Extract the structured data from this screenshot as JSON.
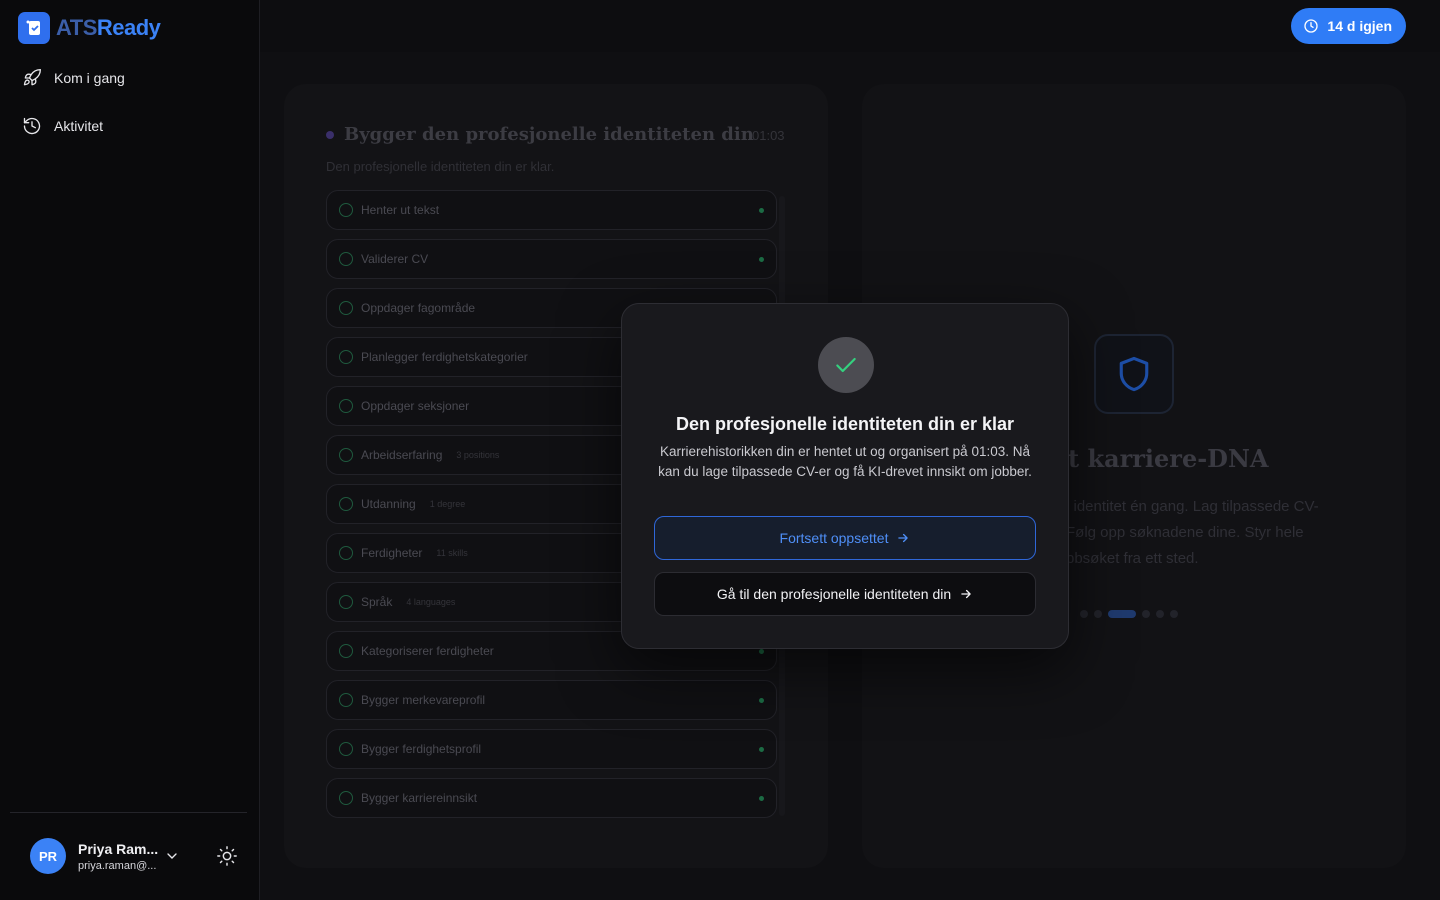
{
  "brand": {
    "name_part1": "ATS",
    "name_part2": "Ready"
  },
  "sidebar": {
    "nav": [
      {
        "label": "Kom i gang",
        "icon": "rocket-icon"
      },
      {
        "label": "Aktivitet",
        "icon": "history-icon"
      }
    ],
    "user": {
      "initials": "PR",
      "name": "Priya Ram...",
      "email": "priya.raman@..."
    }
  },
  "topbar": {
    "trial_label": "14 d igjen"
  },
  "background": {
    "progress_title": "Bygger den profesjonelle identiteten din",
    "progress_time": "01:03",
    "progress_subtitle": "Den profesjonelle identiteten din er klar.",
    "steps": [
      {
        "label": "Henter ut tekst",
        "meta": ""
      },
      {
        "label": "Validerer CV",
        "meta": ""
      },
      {
        "label": "Oppdager fagområde",
        "meta": ""
      },
      {
        "label": "Planlegger ferdighetskategorier",
        "meta": ""
      },
      {
        "label": "Oppdager seksjoner",
        "meta": ""
      },
      {
        "label": "Arbeidserfaring",
        "meta": "3 positions"
      },
      {
        "label": "Utdanning",
        "meta": "1 degree"
      },
      {
        "label": "Ferdigheter",
        "meta": "11 skills"
      },
      {
        "label": "Språk",
        "meta": "4 languages"
      },
      {
        "label": "Kategoriserer ferdigheter",
        "meta": ""
      },
      {
        "label": "Bygger merkevareprofil",
        "meta": ""
      },
      {
        "label": "Bygger ferdighetsprofil",
        "meta": ""
      },
      {
        "label": "Bygger karriereinnsikt",
        "meta": ""
      }
    ],
    "promo_title": "t karriere-DNA",
    "promo_text": "l identitet én gang. Lag tilpassede CV-\nFølg opp søknadene dine. Styr hele\nbbsøket fra ett sted."
  },
  "modal": {
    "title": "Den profesjonelle identiteten din er klar",
    "body": "Karrierehistorikken din er hentet ut og organisert på 01:03. Nå kan du lage tilpassede CV-er og få KI-drevet innsikt om jobber.",
    "primary_label": "Fortsett oppsettet",
    "secondary_label": "Gå til den profesjonelle identiteten din"
  },
  "colors": {
    "accent": "#2f7cf6",
    "success": "#34d17f"
  }
}
